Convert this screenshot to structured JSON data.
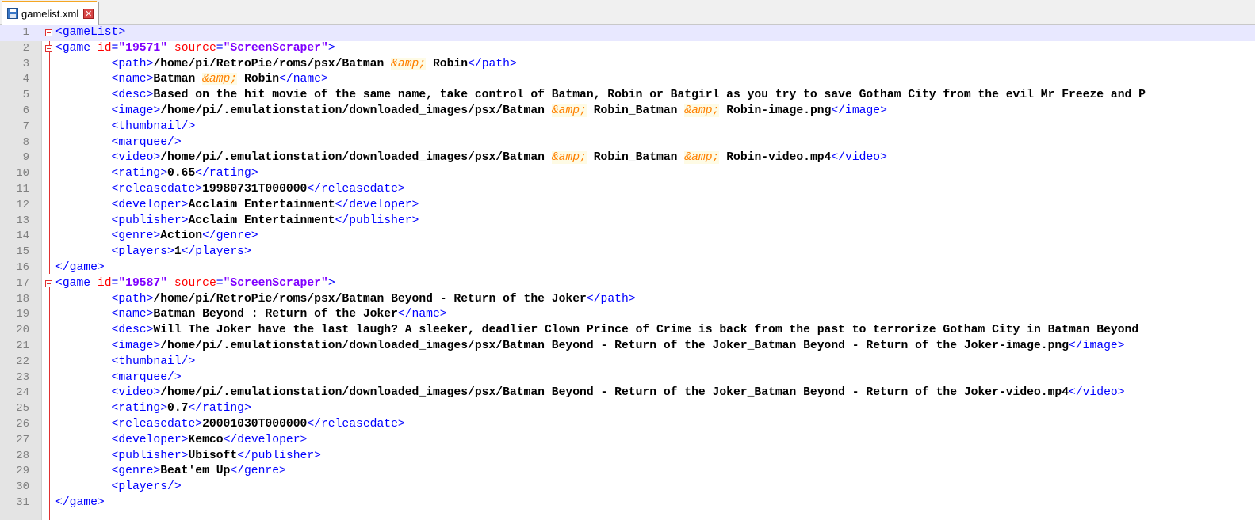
{
  "tab": {
    "filename": "gamelist.xml",
    "close_glyph": "✕"
  },
  "editor": {
    "lines": [
      {
        "n": "1",
        "fold": "open",
        "indent": "",
        "parts": [
          {
            "c": "t",
            "s": "<gameList>"
          }
        ]
      },
      {
        "n": "2",
        "fold": "open",
        "indent": "",
        "parts": [
          {
            "c": "t",
            "s": "<game "
          },
          {
            "c": "a",
            "s": "id"
          },
          {
            "c": "t",
            "s": "="
          },
          {
            "c": "v",
            "s": "\"19571\""
          },
          {
            "c": "a",
            "s": " source"
          },
          {
            "c": "t",
            "s": "="
          },
          {
            "c": "v",
            "s": "\"ScreenScraper\""
          },
          {
            "c": "t",
            "s": ">"
          }
        ]
      },
      {
        "n": "3",
        "indent": "        ",
        "parts": [
          {
            "c": "t",
            "s": "<path>"
          },
          {
            "c": "x",
            "s": "/home/pi/RetroPie/roms/psx/Batman "
          },
          {
            "c": "ent",
            "s": "&amp;"
          },
          {
            "c": "x",
            "s": " Robin"
          },
          {
            "c": "t",
            "s": "</path>"
          }
        ]
      },
      {
        "n": "4",
        "indent": "        ",
        "parts": [
          {
            "c": "t",
            "s": "<name>"
          },
          {
            "c": "x",
            "s": "Batman "
          },
          {
            "c": "ent",
            "s": "&amp;"
          },
          {
            "c": "x",
            "s": " Robin"
          },
          {
            "c": "t",
            "s": "</name>"
          }
        ]
      },
      {
        "n": "5",
        "indent": "        ",
        "parts": [
          {
            "c": "t",
            "s": "<desc>"
          },
          {
            "c": "x",
            "s": "Based on the hit movie of the same name, take control of Batman, Robin or Batgirl as you try to save Gotham City from the evil Mr Freeze and P"
          }
        ]
      },
      {
        "n": "6",
        "indent": "        ",
        "parts": [
          {
            "c": "t",
            "s": "<image>"
          },
          {
            "c": "x",
            "s": "/home/pi/.emulationstation/downloaded_images/psx/Batman "
          },
          {
            "c": "ent",
            "s": "&amp;"
          },
          {
            "c": "x",
            "s": " Robin_Batman "
          },
          {
            "c": "ent",
            "s": "&amp;"
          },
          {
            "c": "x",
            "s": " Robin-image.png"
          },
          {
            "c": "t",
            "s": "</image>"
          }
        ]
      },
      {
        "n": "7",
        "indent": "        ",
        "parts": [
          {
            "c": "t",
            "s": "<thumbnail/>"
          }
        ]
      },
      {
        "n": "8",
        "indent": "        ",
        "parts": [
          {
            "c": "t",
            "s": "<marquee/>"
          }
        ]
      },
      {
        "n": "9",
        "indent": "        ",
        "parts": [
          {
            "c": "t",
            "s": "<video>"
          },
          {
            "c": "x",
            "s": "/home/pi/.emulationstation/downloaded_images/psx/Batman "
          },
          {
            "c": "ent",
            "s": "&amp;"
          },
          {
            "c": "x",
            "s": " Robin_Batman "
          },
          {
            "c": "ent",
            "s": "&amp;"
          },
          {
            "c": "x",
            "s": " Robin-video.mp4"
          },
          {
            "c": "t",
            "s": "</video>"
          }
        ]
      },
      {
        "n": "10",
        "indent": "        ",
        "parts": [
          {
            "c": "t",
            "s": "<rating>"
          },
          {
            "c": "x",
            "s": "0.65"
          },
          {
            "c": "t",
            "s": "</rating>"
          }
        ]
      },
      {
        "n": "11",
        "indent": "        ",
        "parts": [
          {
            "c": "t",
            "s": "<releasedate>"
          },
          {
            "c": "x",
            "s": "19980731T000000"
          },
          {
            "c": "t",
            "s": "</releasedate>"
          }
        ]
      },
      {
        "n": "12",
        "indent": "        ",
        "parts": [
          {
            "c": "t",
            "s": "<developer>"
          },
          {
            "c": "x",
            "s": "Acclaim Entertainment"
          },
          {
            "c": "t",
            "s": "</developer>"
          }
        ]
      },
      {
        "n": "13",
        "indent": "        ",
        "parts": [
          {
            "c": "t",
            "s": "<publisher>"
          },
          {
            "c": "x",
            "s": "Acclaim Entertainment"
          },
          {
            "c": "t",
            "s": "</publisher>"
          }
        ]
      },
      {
        "n": "14",
        "indent": "        ",
        "parts": [
          {
            "c": "t",
            "s": "<genre>"
          },
          {
            "c": "x",
            "s": "Action"
          },
          {
            "c": "t",
            "s": "</genre>"
          }
        ]
      },
      {
        "n": "15",
        "indent": "        ",
        "parts": [
          {
            "c": "t",
            "s": "<players>"
          },
          {
            "c": "x",
            "s": "1"
          },
          {
            "c": "t",
            "s": "</players>"
          }
        ]
      },
      {
        "n": "16",
        "fold": "end",
        "indent": "",
        "parts": [
          {
            "c": "t",
            "s": "</game>"
          }
        ]
      },
      {
        "n": "17",
        "fold": "open",
        "indent": "",
        "parts": [
          {
            "c": "t",
            "s": "<game "
          },
          {
            "c": "a",
            "s": "id"
          },
          {
            "c": "t",
            "s": "="
          },
          {
            "c": "v",
            "s": "\"19587\""
          },
          {
            "c": "a",
            "s": " source"
          },
          {
            "c": "t",
            "s": "="
          },
          {
            "c": "v",
            "s": "\"ScreenScraper\""
          },
          {
            "c": "t",
            "s": ">"
          }
        ]
      },
      {
        "n": "18",
        "indent": "        ",
        "parts": [
          {
            "c": "t",
            "s": "<path>"
          },
          {
            "c": "x",
            "s": "/home/pi/RetroPie/roms/psx/Batman Beyond - Return of the Joker"
          },
          {
            "c": "t",
            "s": "</path>"
          }
        ]
      },
      {
        "n": "19",
        "indent": "        ",
        "parts": [
          {
            "c": "t",
            "s": "<name>"
          },
          {
            "c": "x",
            "s": "Batman Beyond : Return of the Joker"
          },
          {
            "c": "t",
            "s": "</name>"
          }
        ]
      },
      {
        "n": "20",
        "indent": "        ",
        "parts": [
          {
            "c": "t",
            "s": "<desc>"
          },
          {
            "c": "x",
            "s": "Will The Joker have the last laugh? A sleeker, deadlier Clown Prince of Crime is back from the past to terrorize Gotham City in Batman Beyond"
          }
        ]
      },
      {
        "n": "21",
        "indent": "        ",
        "parts": [
          {
            "c": "t",
            "s": "<image>"
          },
          {
            "c": "x",
            "s": "/home/pi/.emulationstation/downloaded_images/psx/Batman Beyond - Return of the Joker_Batman Beyond - Return of the Joker-image.png"
          },
          {
            "c": "t",
            "s": "</image>"
          }
        ]
      },
      {
        "n": "22",
        "indent": "        ",
        "parts": [
          {
            "c": "t",
            "s": "<thumbnail/>"
          }
        ]
      },
      {
        "n": "23",
        "indent": "        ",
        "parts": [
          {
            "c": "t",
            "s": "<marquee/>"
          }
        ]
      },
      {
        "n": "24",
        "indent": "        ",
        "parts": [
          {
            "c": "t",
            "s": "<video>"
          },
          {
            "c": "x",
            "s": "/home/pi/.emulationstation/downloaded_images/psx/Batman Beyond - Return of the Joker_Batman Beyond - Return of the Joker-video.mp4"
          },
          {
            "c": "t",
            "s": "</video>"
          }
        ]
      },
      {
        "n": "25",
        "indent": "        ",
        "parts": [
          {
            "c": "t",
            "s": "<rating>"
          },
          {
            "c": "x",
            "s": "0.7"
          },
          {
            "c": "t",
            "s": "</rating>"
          }
        ]
      },
      {
        "n": "26",
        "indent": "        ",
        "parts": [
          {
            "c": "t",
            "s": "<releasedate>"
          },
          {
            "c": "x",
            "s": "20001030T000000"
          },
          {
            "c": "t",
            "s": "</releasedate>"
          }
        ]
      },
      {
        "n": "27",
        "indent": "        ",
        "parts": [
          {
            "c": "t",
            "s": "<developer>"
          },
          {
            "c": "x",
            "s": "Kemco"
          },
          {
            "c": "t",
            "s": "</developer>"
          }
        ]
      },
      {
        "n": "28",
        "indent": "        ",
        "parts": [
          {
            "c": "t",
            "s": "<publisher>"
          },
          {
            "c": "x",
            "s": "Ubisoft"
          },
          {
            "c": "t",
            "s": "</publisher>"
          }
        ]
      },
      {
        "n": "29",
        "indent": "        ",
        "parts": [
          {
            "c": "t",
            "s": "<genre>"
          },
          {
            "c": "x",
            "s": "Beat'em Up"
          },
          {
            "c": "t",
            "s": "</genre>"
          }
        ]
      },
      {
        "n": "30",
        "indent": "        ",
        "parts": [
          {
            "c": "t",
            "s": "<players/>"
          }
        ]
      },
      {
        "n": "31",
        "fold": "end",
        "indent": "",
        "parts": [
          {
            "c": "t",
            "s": "</game>"
          }
        ]
      }
    ]
  }
}
